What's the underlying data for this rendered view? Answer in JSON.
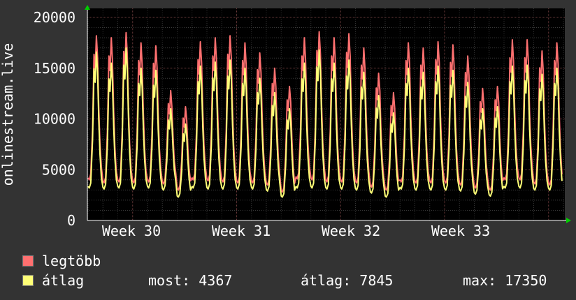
{
  "chart_data": {
    "type": "line",
    "ylabel": "onlinestream.live",
    "ylim": [
      0,
      20000
    ],
    "y_ticks": [
      {
        "value": 0,
        "label": "0"
      },
      {
        "value": 5000,
        "label": "5000"
      },
      {
        "value": 10000,
        "label": "10000"
      },
      {
        "value": 15000,
        "label": "15000"
      },
      {
        "value": 20000,
        "label": "20000"
      }
    ],
    "x_labels": [
      "Week 30",
      "Week 31",
      "Week 32",
      "Week 33"
    ],
    "grid": true,
    "series": [
      {
        "name": "legtöbb",
        "color": "#ff7070",
        "daily": [
          {
            "peak": 18200,
            "low": 4000
          },
          {
            "peak": 18000,
            "low": 3700
          },
          {
            "peak": 18500,
            "low": 3800
          },
          {
            "peak": 17500,
            "low": 3700
          },
          {
            "peak": 17200,
            "low": 3800
          },
          {
            "peak": 12800,
            "low": 3600
          },
          {
            "peak": 11200,
            "low": 3000
          },
          {
            "peak": 17600,
            "low": 4000
          },
          {
            "peak": 18000,
            "low": 3900
          },
          {
            "peak": 18200,
            "low": 3800
          },
          {
            "peak": 17500,
            "low": 3700
          },
          {
            "peak": 16500,
            "low": 3700
          },
          {
            "peak": 15000,
            "low": 3500
          },
          {
            "peak": 13200,
            "low": 2800
          },
          {
            "peak": 18000,
            "low": 4100
          },
          {
            "peak": 18600,
            "low": 4000
          },
          {
            "peak": 18000,
            "low": 3800
          },
          {
            "peak": 18400,
            "low": 3800
          },
          {
            "peak": 17000,
            "low": 3700
          },
          {
            "peak": 14500,
            "low": 3300
          },
          {
            "peak": 12600,
            "low": 3000
          },
          {
            "peak": 17500,
            "low": 3800
          },
          {
            "peak": 17000,
            "low": 3700
          },
          {
            "peak": 17600,
            "low": 3700
          },
          {
            "peak": 17300,
            "low": 3700
          },
          {
            "peak": 16200,
            "low": 3500
          },
          {
            "peak": 13000,
            "low": 3200
          },
          {
            "peak": 13200,
            "low": 3000
          },
          {
            "peak": 17800,
            "low": 4000
          },
          {
            "peak": 17800,
            "low": 4000
          },
          {
            "peak": 16700,
            "low": 3600
          },
          {
            "peak": 17500,
            "low": 3500
          }
        ]
      },
      {
        "name": "átlag",
        "color": "#ffff77",
        "daily": [
          {
            "peak": 16600,
            "low": 3200
          },
          {
            "peak": 15500,
            "low": 3100
          },
          {
            "peak": 17000,
            "low": 3200
          },
          {
            "peak": 15000,
            "low": 3100
          },
          {
            "peak": 14800,
            "low": 3200
          },
          {
            "peak": 11000,
            "low": 3000
          },
          {
            "peak": 9500,
            "low": 2300
          },
          {
            "peak": 15200,
            "low": 3200
          },
          {
            "peak": 15600,
            "low": 3100
          },
          {
            "peak": 15800,
            "low": 3100
          },
          {
            "peak": 15000,
            "low": 3100
          },
          {
            "peak": 14000,
            "low": 3100
          },
          {
            "peak": 12600,
            "low": 2900
          },
          {
            "peak": 11000,
            "low": 2300
          },
          {
            "peak": 15500,
            "low": 3200
          },
          {
            "peak": 16800,
            "low": 3200
          },
          {
            "peak": 15500,
            "low": 3100
          },
          {
            "peak": 15800,
            "low": 3100
          },
          {
            "peak": 14600,
            "low": 3000
          },
          {
            "peak": 12300,
            "low": 2700
          },
          {
            "peak": 10600,
            "low": 2300
          },
          {
            "peak": 15000,
            "low": 3100
          },
          {
            "peak": 14600,
            "low": 3000
          },
          {
            "peak": 15200,
            "low": 3000
          },
          {
            "peak": 14800,
            "low": 3000
          },
          {
            "peak": 13600,
            "low": 2900
          },
          {
            "peak": 11000,
            "low": 2600
          },
          {
            "peak": 11200,
            "low": 2400
          },
          {
            "peak": 15200,
            "low": 3200
          },
          {
            "peak": 15300,
            "low": 3200
          },
          {
            "peak": 14400,
            "low": 3000
          },
          {
            "peak": 15000,
            "low": 3000
          }
        ]
      }
    ]
  },
  "legend": [
    {
      "label": "legtöbb",
      "color": "#ff7070"
    },
    {
      "label": "átlag",
      "color": "#ffff77"
    }
  ],
  "stats": {
    "most": "most: 4367",
    "atlag": "átlag: 7845",
    "max": "max: 17350"
  }
}
